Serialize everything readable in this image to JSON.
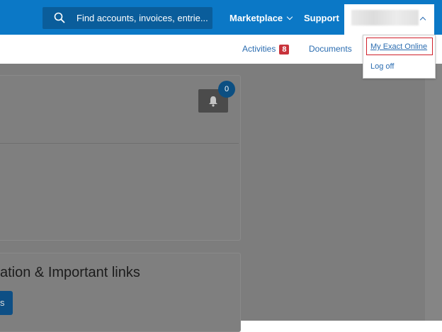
{
  "header": {
    "search_placeholder": "Find accounts, invoices, entrie...",
    "marketplace_label": "Marketplace",
    "support_label": "Support"
  },
  "subnav": {
    "activities_label": "Activities",
    "activities_count": "8",
    "documents_label": "Documents"
  },
  "user_dropdown": {
    "items": [
      {
        "label": "My Exact Online"
      },
      {
        "label": "Log off"
      }
    ]
  },
  "notifications": {
    "count": "0"
  },
  "section": {
    "title": "ation & Important links",
    "button_label": "s"
  },
  "colors": {
    "topbar": "#0b78c6",
    "accent": "#2a6cb0",
    "badge": "#c8333b",
    "overlay": "#7d7d7d"
  },
  "icons": [
    "search-icon",
    "chevron-down-icon",
    "chevron-up-icon",
    "bell-icon"
  ]
}
